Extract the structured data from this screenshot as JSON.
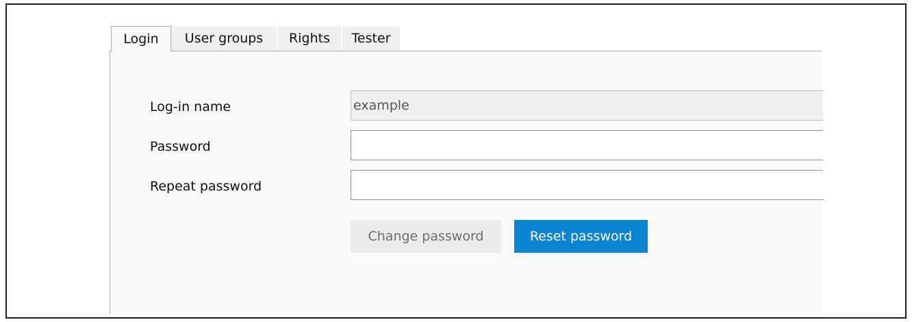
{
  "tabs": [
    {
      "label": "Login",
      "active": true
    },
    {
      "label": "User groups",
      "active": false
    },
    {
      "label": "Rights",
      "active": false
    },
    {
      "label": "Tester",
      "active": false
    }
  ],
  "form": {
    "login_name": {
      "label": "Log-in name",
      "value": "example",
      "readonly": true
    },
    "password": {
      "label": "Password",
      "value": ""
    },
    "repeat_password": {
      "label": "Repeat password",
      "value": ""
    }
  },
  "buttons": {
    "change_password": {
      "label": "Change password",
      "enabled": false
    },
    "reset_password": {
      "label": "Reset password",
      "enabled": true
    }
  },
  "colors": {
    "accent": "#0a84d0",
    "panel_background": "#f9f9f9",
    "tab_border": "#adadad"
  }
}
